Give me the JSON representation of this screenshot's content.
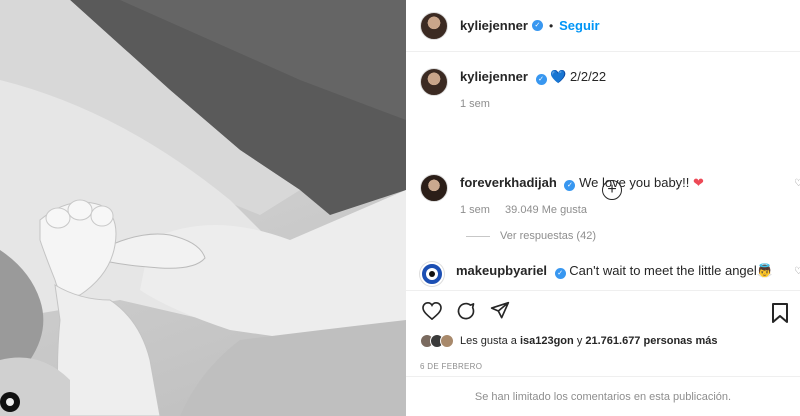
{
  "post": {
    "username": "kyliejenner",
    "follow_label": "Seguir",
    "dot": "•"
  },
  "caption": {
    "username": "kyliejenner",
    "heart": "💙",
    "text": "2/2/22",
    "age": "1 sem"
  },
  "comments": [
    {
      "username": "foreverkhadijah",
      "text": "We love you baby!!",
      "heart": "❤",
      "age": "1 sem",
      "likes": "39.049 Me gusta"
    },
    {
      "username": "makeupbyariel",
      "text": "Can't wait to meet the little angel👼"
    }
  ],
  "replies_label": "Ver respuestas (42)",
  "likes": {
    "prefix": "Les gusta a",
    "user": "isa123gon",
    "middle": "y",
    "count": "21.761.677 personas más"
  },
  "date": "6 DE FEBRERO",
  "comments_limited": "Se han limitado los comentarios en esta publicación.",
  "icons": {
    "like": "heart-icon",
    "comment": "comment-icon",
    "share": "send-icon",
    "save": "bookmark-icon",
    "add": "plus-circle-icon",
    "verified": "verified-badge-icon"
  },
  "colors": {
    "follow_blue": "#0095f6",
    "verified_blue": "#3897f0",
    "muted_gray": "#8e8e8e"
  }
}
